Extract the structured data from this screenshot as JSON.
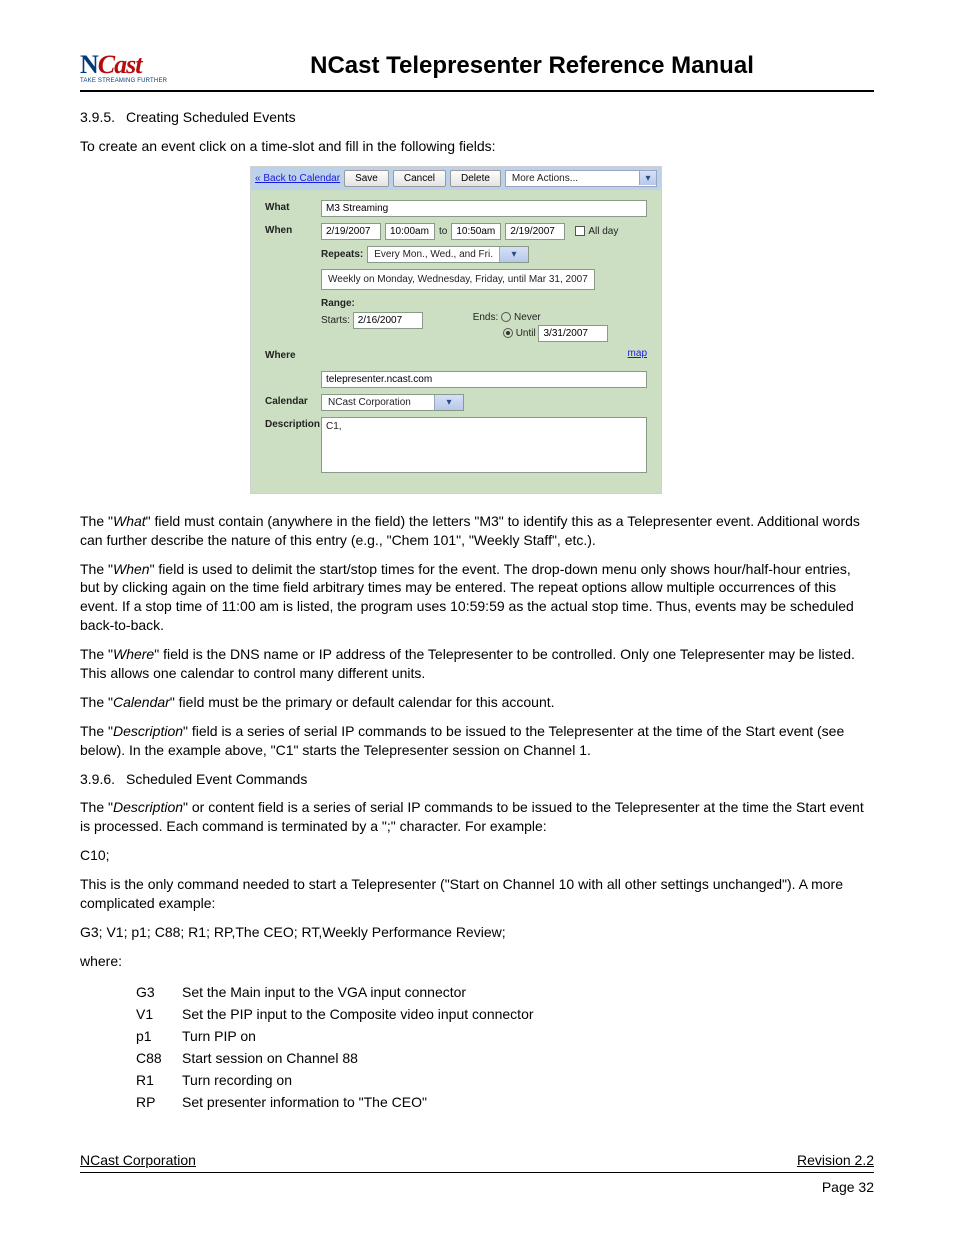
{
  "header": {
    "logo": {
      "n": "N",
      "cast": "Cast",
      "tagline": "TAKE STREAMING FURTHER"
    },
    "title": "NCast Telepresenter Reference Manual"
  },
  "section1": {
    "number": "3.9.5.",
    "title": "Creating Scheduled Events"
  },
  "intro": "To create an event click on a time-slot and fill in the following fields:",
  "shot": {
    "back": "« Back to Calendar",
    "buttons": {
      "save": "Save",
      "cancel": "Cancel",
      "delete": "Delete"
    },
    "more": "More Actions...",
    "labels": {
      "what": "What",
      "when": "When",
      "where": "Where",
      "calendar": "Calendar",
      "description": "Description",
      "to": "to",
      "allday": "All day",
      "repeats": "Repeats:",
      "range": "Range:",
      "starts": "Starts:",
      "ends": "Ends:",
      "never": "Never",
      "until": "Until",
      "map": "map"
    },
    "what": "M3 Streaming",
    "when": {
      "date1": "2/19/2007",
      "time1": "10:00am",
      "time2": "10:50am",
      "date2": "2/19/2007",
      "repeats_value": "Every Mon., Wed., and Fri.",
      "recur_text": "Weekly on Monday, Wednesday, Friday, until Mar 31, 2007",
      "range_start": "2/16/2007",
      "range_until": "3/31/2007"
    },
    "where": "telepresenter.ncast.com",
    "calendar": "NCast Corporation",
    "description": "C1,"
  },
  "para_what_a": "The \"",
  "para_what_b": "What",
  "para_what_c": "\" field must contain (anywhere in the field) the letters \"M3\" to identify this as a Telepresenter event. Additional words can further describe the nature of this entry (e.g., \"Chem 101\", \"Weekly Staff\", etc.).",
  "para_when_a": "The \"",
  "para_when_b": "When",
  "para_when_c": "\" field is used to delimit the start/stop times for the event. The drop-down menu only shows hour/half-hour entries, but by clicking again on the time field arbitrary times may be entered. The repeat options allow multiple occurrences of this event. If a stop time of 11:00 am is listed, the program uses 10:59:59 as the actual stop time. Thus, events may be scheduled back-to-back.",
  "para_where_a": "The \"",
  "para_where_b": "Where",
  "para_where_c": "\" field is the DNS name or IP address of the Telepresenter to be controlled. Only one Telepresenter may be listed. This allows one calendar to control many different units.",
  "para_cal_a": "The \"",
  "para_cal_b": "Calendar",
  "para_cal_c": "\" field must be the primary or default calendar for this account.",
  "para_desc_a": "The \"",
  "para_desc_b": "Description",
  "para_desc_c": "\" field is a series of serial IP commands to be issued to the Telepresenter at the time of the Start event (see below). In the example above, \"C1\" starts the Telepresenter session on Channel 1.",
  "section2": {
    "number": "3.9.6.",
    "title": "Scheduled Event Commands"
  },
  "para2_a": "The \"",
  "para2_b": "Description",
  "para2_c": "\" or content field is a series of serial IP commands to be issued to the Telepresenter at the time the Start event is processed. Each command is terminated by a \";\" character. For example:",
  "example1": "C10;",
  "para3": "This is the only command needed to start a Telepresenter (\"Start on Channel 10 with all other settings unchanged\"). A more complicated example:",
  "example2": "G3; V1; p1; C88; R1; RP,The CEO; RT,Weekly Performance Review;",
  "where_label": "where:",
  "cmds": [
    {
      "c": "G3",
      "d": "Set the Main input to the VGA input connector"
    },
    {
      "c": "V1",
      "d": "Set the PIP input to the Composite video input connector"
    },
    {
      "c": "p1",
      "d": "Turn PIP on"
    },
    {
      "c": "C88",
      "d": "Start session on Channel 88"
    },
    {
      "c": "R1",
      "d": "Turn recording on"
    },
    {
      "c": "RP",
      "d": "Set presenter information to \"The CEO\""
    }
  ],
  "footer": {
    "left": "NCast Corporation",
    "right": "Revision 2.2",
    "page": "Page 32"
  }
}
